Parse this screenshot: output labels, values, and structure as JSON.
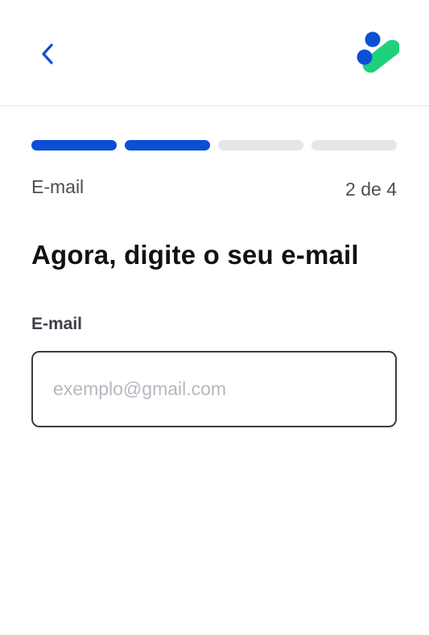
{
  "header": {
    "back_icon": "chevron-left-icon",
    "logo_icon": "brand-logo-icon",
    "colors": {
      "brand_blue": "#0a4fd6",
      "brand_green": "#1fd17a"
    }
  },
  "progress": {
    "current_step": 2,
    "total_steps": 4,
    "step_label": "E-mail",
    "step_counter": "2 de 4",
    "active_color": "#0a4fd6",
    "inactive_color": "#e4e6ea"
  },
  "main": {
    "title": "Agora, digite o seu e-mail",
    "email_field": {
      "label": "E-mail",
      "value": "",
      "placeholder": "exemplo@gmail.com"
    }
  }
}
